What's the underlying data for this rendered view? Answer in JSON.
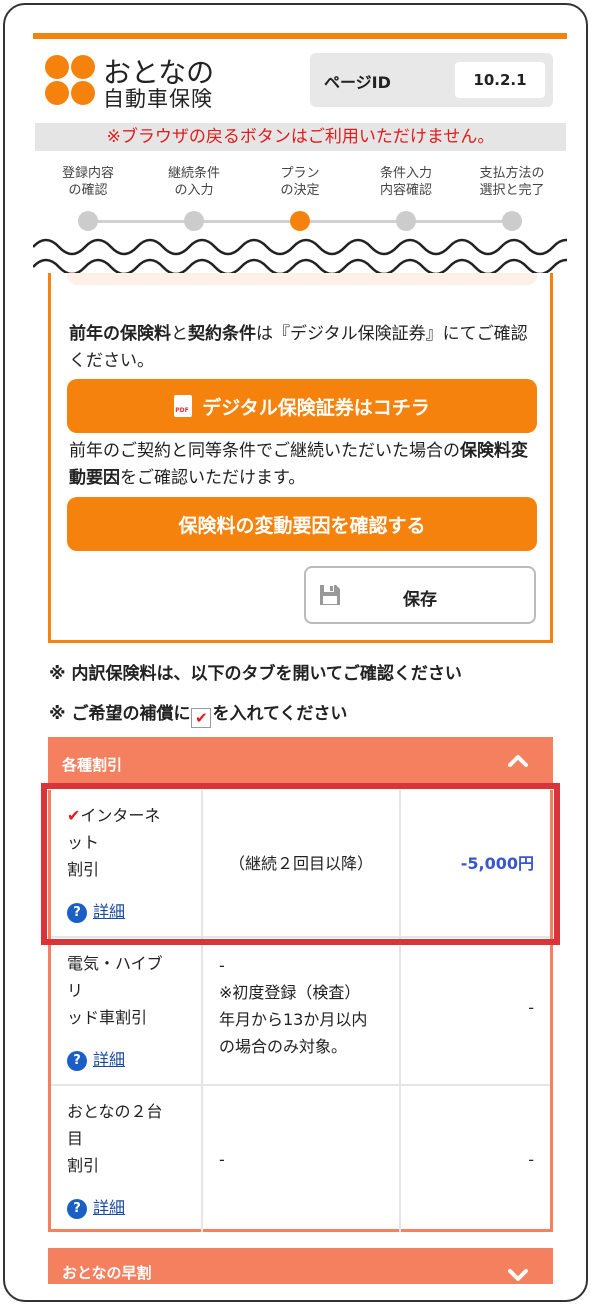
{
  "header": {
    "logo_line1": "おとなの",
    "logo_line2": "自動車保険",
    "page_id_label": "ページID",
    "page_id_value": "10.2.1"
  },
  "notice": "※ブラウザの戻るボタンはご利用いただけません。",
  "steps": [
    {
      "line1": "登録内容",
      "line2": "の確認"
    },
    {
      "line1": "継続条件",
      "line2": "の入力"
    },
    {
      "line1": "プラン",
      "line2": "の決定"
    },
    {
      "line1": "条件入力",
      "line2": "内容確認"
    },
    {
      "line1": "支払方法の",
      "line2": "選択と完了"
    }
  ],
  "active_step": 3,
  "card": {
    "text1_bold1": "前年の保険料",
    "text1_mid": "と",
    "text1_bold2": "契約条件",
    "text1_rest": "は『デジタル保険証券』にてご確認ください。",
    "digital_button": "デジタル保険証券はコチラ",
    "text2_start": "前年のご契約と同等条件でご継続いただいた場合の",
    "text2_bold": "保険料変動要因",
    "text2_end": "をご確認いただけます。",
    "factor_button": "保険料の変動要因を確認する",
    "save_button": "保存"
  },
  "notes": {
    "note1": "※ 内訳保険料は、以下のタブを開いてご確認ください",
    "note2_start": "※ ご希望の補償に",
    "note2_check": "✔",
    "note2_end": "を入れてください"
  },
  "accordion": {
    "discounts_title": "各種割引",
    "next_title": "おとなの早割"
  },
  "discount_rows": [
    {
      "name_l1": "インターネ",
      "name_l2": "ット",
      "name_l3": "割引",
      "condition": "（継続２回目以降）",
      "amount": "-5,000円",
      "detail": "詳細"
    },
    {
      "name_l1": "電気・ハイブ",
      "name_l2": "リ",
      "name_l3": "ッド車割引",
      "condition_l1": "-",
      "condition_l2": "※初度登録（検査）",
      "condition_l3": "年月から13か月以内",
      "condition_l4": "の場合のみ対象。",
      "amount": "-",
      "detail": "詳細"
    },
    {
      "name_l1": "おとなの２台",
      "name_l2": "目",
      "name_l3": "割引",
      "condition": "-",
      "amount": "-",
      "detail": "詳細"
    }
  ],
  "colors": {
    "brand_orange": "#f5820d",
    "accordion_salmon": "#f4805f",
    "notice_red": "#e21b1b",
    "price_blue": "#3a55d1",
    "highlight_red": "#d8343a"
  }
}
